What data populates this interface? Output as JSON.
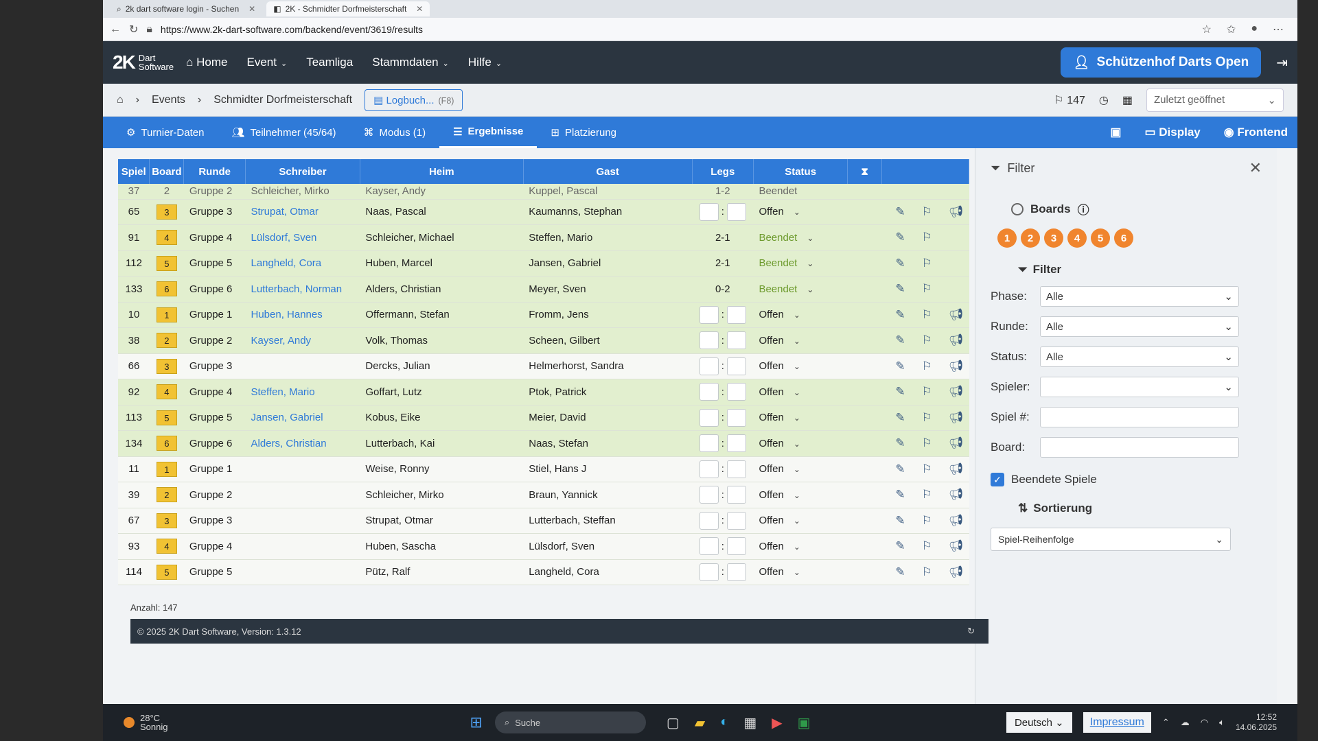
{
  "browser": {
    "tabs": [
      {
        "title": "2k dart software login - Suchen",
        "active": false
      },
      {
        "title": "2K - Schmidter Dorfmeisterschaft",
        "active": true
      }
    ],
    "url": "https://www.2k-dart-software.com/backend/event/3619/results"
  },
  "app": {
    "logo_mark": "2K",
    "logo_line1": "Dart",
    "logo_line2": "Software",
    "nav": [
      "Home",
      "Event",
      "Teamliga",
      "Stammdaten",
      "Hilfe"
    ],
    "event_button": "Schützenhof Darts Open"
  },
  "breadcrumb": {
    "items": [
      "Events",
      "Schmidter Dorfmeisterschaft"
    ],
    "logbuch": "Logbuch...",
    "logbuch_key": "(F8)",
    "flag_count": "147",
    "recent": "Zuletzt geöffnet"
  },
  "tabs": [
    {
      "label": "Turnier-Daten"
    },
    {
      "label": "Teilnehmer (45/64)"
    },
    {
      "label": "Modus (1)"
    },
    {
      "label": "Ergebnisse",
      "active": true
    },
    {
      "label": "Platzierung"
    }
  ],
  "tabs_right": {
    "display": "Display",
    "frontend": "Frontend"
  },
  "table": {
    "headers": [
      "Spiel",
      "Board",
      "Runde",
      "Schreiber",
      "Heim",
      "Gast",
      "Legs",
      "Status",
      "X"
    ],
    "partial_row": {
      "spiel": "37",
      "board": "2",
      "runde": "Gruppe 2",
      "schreiber": "Schleicher, Mirko",
      "heim": "Kayser, Andy",
      "gast": "Kuppel, Pascal",
      "legs": "1-2",
      "status": "Beendet"
    },
    "rows": [
      {
        "spiel": "65",
        "board": "3",
        "runde": "Gruppe 3",
        "schreiber": "Strupat, Otmar",
        "heim": "Naas, Pascal",
        "gast": "Kaumanns, Stephan",
        "legs": "",
        "status": "Offen",
        "color": "green"
      },
      {
        "spiel": "91",
        "board": "4",
        "runde": "Gruppe 4",
        "schreiber": "Lülsdorf, Sven",
        "heim": "Schleicher, Michael",
        "gast": "Steffen, Mario",
        "legs": "2-1",
        "status": "Beendet",
        "color": "green"
      },
      {
        "spiel": "112",
        "board": "5",
        "runde": "Gruppe 5",
        "schreiber": "Langheld, Cora",
        "heim": "Huben, Marcel",
        "gast": "Jansen, Gabriel",
        "legs": "2-1",
        "status": "Beendet",
        "color": "green"
      },
      {
        "spiel": "133",
        "board": "6",
        "runde": "Gruppe 6",
        "schreiber": "Lutterbach, Norman",
        "heim": "Alders, Christian",
        "gast": "Meyer, Sven",
        "legs": "0-2",
        "status": "Beendet",
        "color": "green"
      },
      {
        "spiel": "10",
        "board": "1",
        "runde": "Gruppe 1",
        "schreiber": "Huben, Hannes",
        "heim": "Offermann, Stefan",
        "gast": "Fromm, Jens",
        "legs": "",
        "status": "Offen",
        "color": "green"
      },
      {
        "spiel": "38",
        "board": "2",
        "runde": "Gruppe 2",
        "schreiber": "Kayser, Andy",
        "heim": "Volk, Thomas",
        "gast": "Scheen, Gilbert",
        "legs": "",
        "status": "Offen",
        "color": "green"
      },
      {
        "spiel": "66",
        "board": "3",
        "runde": "Gruppe 3",
        "schreiber": "",
        "heim": "Dercks, Julian",
        "gast": "Helmerhorst, Sandra",
        "legs": "",
        "status": "Offen",
        "color": "white"
      },
      {
        "spiel": "92",
        "board": "4",
        "runde": "Gruppe 4",
        "schreiber": "Steffen, Mario",
        "heim": "Goffart, Lutz",
        "gast": "Ptok, Patrick",
        "legs": "",
        "status": "Offen",
        "color": "green"
      },
      {
        "spiel": "113",
        "board": "5",
        "runde": "Gruppe 5",
        "schreiber": "Jansen, Gabriel",
        "heim": "Kobus, Eike",
        "gast": "Meier, David",
        "legs": "",
        "status": "Offen",
        "color": "green"
      },
      {
        "spiel": "134",
        "board": "6",
        "runde": "Gruppe 6",
        "schreiber": "Alders, Christian",
        "heim": "Lutterbach, Kai",
        "gast": "Naas, Stefan",
        "legs": "",
        "status": "Offen",
        "color": "green"
      },
      {
        "spiel": "11",
        "board": "1",
        "runde": "Gruppe 1",
        "schreiber": "",
        "heim": "Weise, Ronny",
        "gast": "Stiel, Hans J",
        "legs": "",
        "status": "Offen",
        "color": "white"
      },
      {
        "spiel": "39",
        "board": "2",
        "runde": "Gruppe 2",
        "schreiber": "",
        "heim": "Schleicher, Mirko",
        "gast": "Braun, Yannick",
        "legs": "",
        "status": "Offen",
        "color": "white"
      },
      {
        "spiel": "67",
        "board": "3",
        "runde": "Gruppe 3",
        "schreiber": "",
        "heim": "Strupat, Otmar",
        "gast": "Lutterbach, Steffan",
        "legs": "",
        "status": "Offen",
        "color": "white"
      },
      {
        "spiel": "93",
        "board": "4",
        "runde": "Gruppe 4",
        "schreiber": "",
        "heim": "Huben, Sascha",
        "gast": "Lülsdorf, Sven",
        "legs": "",
        "status": "Offen",
        "color": "white"
      },
      {
        "spiel": "114",
        "board": "5",
        "runde": "Gruppe 5",
        "schreiber": "",
        "heim": "Pütz, Ralf",
        "gast": "Langheld, Cora",
        "legs": "",
        "status": "Offen",
        "color": "white"
      }
    ],
    "count": "Anzahl: 147"
  },
  "filter": {
    "title": "Filter",
    "boards_label": "Boards",
    "boards": [
      "1",
      "2",
      "3",
      "4",
      "5",
      "6"
    ],
    "sub_title": "Filter",
    "fields": [
      {
        "label": "Phase:",
        "value": "Alle"
      },
      {
        "label": "Runde:",
        "value": "Alle"
      },
      {
        "label": "Status:",
        "value": "Alle"
      },
      {
        "label": "Spieler:",
        "value": ""
      },
      {
        "label": "Spiel #:",
        "value": ""
      },
      {
        "label": "Board:",
        "value": ""
      }
    ],
    "finished_games": "Beendete Spiele",
    "sort_title": "Sortierung",
    "sort_value": "Spiel-Reihenfolge"
  },
  "footer": {
    "copyright": "© 2025 2K Dart Software, Version: 1.3.12"
  },
  "taskbar": {
    "temp": "28°C",
    "weather": "Sonnig",
    "search": "Suche",
    "language": "Deutsch",
    "impressum": "Impressum",
    "time": "12:52",
    "date": "14.06.2025"
  },
  "colors": {
    "accent": "#2f7ad8",
    "header": "#2b3540",
    "board_badge": "#f0852e"
  }
}
